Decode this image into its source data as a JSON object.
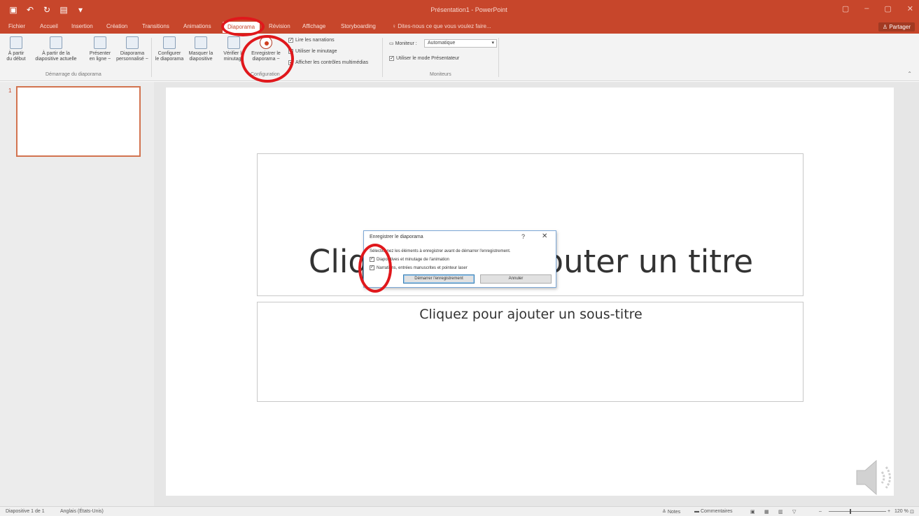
{
  "window": {
    "title": "Présentation1 - PowerPoint",
    "controls": [
      "▢",
      "–",
      "▢",
      "✕"
    ]
  },
  "qat": {
    "save_icon": "save-icon",
    "undo_icon": "undo-icon",
    "redo_icon": "redo-icon",
    "start_icon": "start-slideshow-icon"
  },
  "tabs": [
    {
      "label": "Fichier",
      "active": false
    },
    {
      "label": "Accueil",
      "active": false
    },
    {
      "label": "Insertion",
      "active": false
    },
    {
      "label": "Création",
      "active": false
    },
    {
      "label": "Transitions",
      "active": false
    },
    {
      "label": "Animations",
      "active": false
    },
    {
      "label": "Diaporama",
      "active": true
    },
    {
      "label": "Révision",
      "active": false
    },
    {
      "label": "Affichage",
      "active": false
    },
    {
      "label": "Storyboarding",
      "active": false
    }
  ],
  "tell_me": "Dites-nous ce que vous voulez faire...",
  "share": "Partager",
  "ribbon": {
    "buttons": {
      "from_start": "À partir\ndu début",
      "from_current": "À partir de la\ndiapositive actuelle",
      "present_online": "Présenter\nen ligne ~",
      "custom_show": "Diaporama\npersonnalisé ~",
      "setup": "Configurer\nle diaporama",
      "hide_slide": "Masquer la\ndiapositive",
      "rehearse": "Vérifier le\nminutage",
      "record": "Enregistrer le\ndiaporama ~"
    },
    "groups": {
      "start": "Démarrage du diaporama",
      "setup": "Configuration",
      "monitors": "Moniteurs"
    },
    "checkboxes": {
      "play_narrations": "Lire les narrations",
      "use_timings": "Utiliser le minutage",
      "show_media_controls": "Afficher les contrôles multimédias",
      "presenter_view": "Utiliser le mode Présentateur"
    },
    "monitor": {
      "label": "Moniteur :",
      "value": "Automatique"
    }
  },
  "thumbnails": [
    {
      "number": "1"
    }
  ],
  "slide": {
    "title_placeholder": "Cliquez pour ajouter un titre",
    "subtitle_placeholder": "Cliquez pour ajouter un sous-titre"
  },
  "dialog": {
    "title": "Enregistrer le diaporama",
    "help": "?",
    "close": "✕",
    "instruction": "Sélectionnez les éléments à enregistrer avant de démarrer l'enregistrement.",
    "option1": "Diapositives et minutage de l'animation",
    "option2": "Narrations, entrées manuscrites et pointeur laser",
    "start_button": "Démarrer l'enregistrement",
    "cancel_button": "Annuler"
  },
  "status": {
    "slide_count": "Diapositive 1 de 1",
    "language": "Anglais (États-Unis)",
    "notes": "Notes",
    "comments": "Commentaires",
    "zoom": "120 %"
  },
  "colors": {
    "accent": "#c7462b",
    "annotation": "#e0181c"
  }
}
